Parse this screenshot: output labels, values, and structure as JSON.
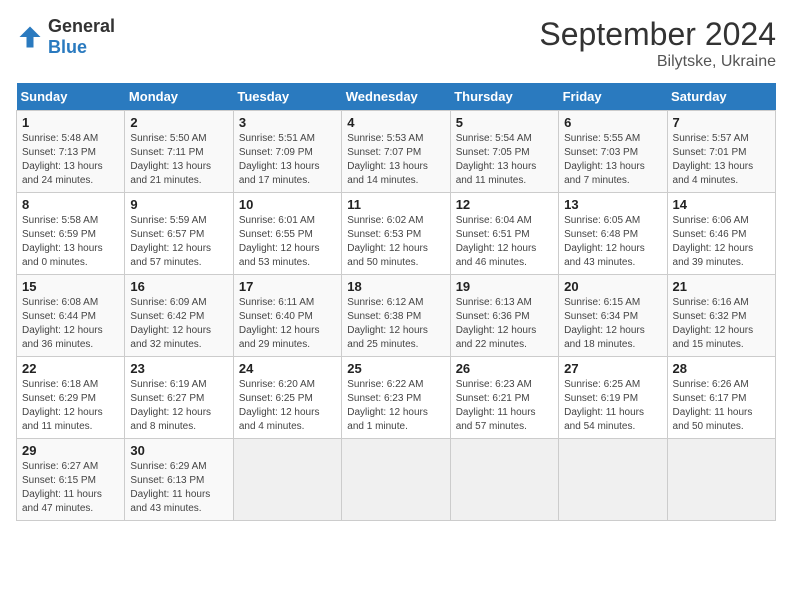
{
  "logo": {
    "general": "General",
    "blue": "Blue"
  },
  "title": "September 2024",
  "subtitle": "Bilytske, Ukraine",
  "days_header": [
    "Sunday",
    "Monday",
    "Tuesday",
    "Wednesday",
    "Thursday",
    "Friday",
    "Saturday"
  ],
  "weeks": [
    [
      {
        "day": "1",
        "info": "Sunrise: 5:48 AM\nSunset: 7:13 PM\nDaylight: 13 hours\nand 24 minutes."
      },
      {
        "day": "2",
        "info": "Sunrise: 5:50 AM\nSunset: 7:11 PM\nDaylight: 13 hours\nand 21 minutes."
      },
      {
        "day": "3",
        "info": "Sunrise: 5:51 AM\nSunset: 7:09 PM\nDaylight: 13 hours\nand 17 minutes."
      },
      {
        "day": "4",
        "info": "Sunrise: 5:53 AM\nSunset: 7:07 PM\nDaylight: 13 hours\nand 14 minutes."
      },
      {
        "day": "5",
        "info": "Sunrise: 5:54 AM\nSunset: 7:05 PM\nDaylight: 13 hours\nand 11 minutes."
      },
      {
        "day": "6",
        "info": "Sunrise: 5:55 AM\nSunset: 7:03 PM\nDaylight: 13 hours\nand 7 minutes."
      },
      {
        "day": "7",
        "info": "Sunrise: 5:57 AM\nSunset: 7:01 PM\nDaylight: 13 hours\nand 4 minutes."
      }
    ],
    [
      {
        "day": "8",
        "info": "Sunrise: 5:58 AM\nSunset: 6:59 PM\nDaylight: 13 hours\nand 0 minutes."
      },
      {
        "day": "9",
        "info": "Sunrise: 5:59 AM\nSunset: 6:57 PM\nDaylight: 12 hours\nand 57 minutes."
      },
      {
        "day": "10",
        "info": "Sunrise: 6:01 AM\nSunset: 6:55 PM\nDaylight: 12 hours\nand 53 minutes."
      },
      {
        "day": "11",
        "info": "Sunrise: 6:02 AM\nSunset: 6:53 PM\nDaylight: 12 hours\nand 50 minutes."
      },
      {
        "day": "12",
        "info": "Sunrise: 6:04 AM\nSunset: 6:51 PM\nDaylight: 12 hours\nand 46 minutes."
      },
      {
        "day": "13",
        "info": "Sunrise: 6:05 AM\nSunset: 6:48 PM\nDaylight: 12 hours\nand 43 minutes."
      },
      {
        "day": "14",
        "info": "Sunrise: 6:06 AM\nSunset: 6:46 PM\nDaylight: 12 hours\nand 39 minutes."
      }
    ],
    [
      {
        "day": "15",
        "info": "Sunrise: 6:08 AM\nSunset: 6:44 PM\nDaylight: 12 hours\nand 36 minutes."
      },
      {
        "day": "16",
        "info": "Sunrise: 6:09 AM\nSunset: 6:42 PM\nDaylight: 12 hours\nand 32 minutes."
      },
      {
        "day": "17",
        "info": "Sunrise: 6:11 AM\nSunset: 6:40 PM\nDaylight: 12 hours\nand 29 minutes."
      },
      {
        "day": "18",
        "info": "Sunrise: 6:12 AM\nSunset: 6:38 PM\nDaylight: 12 hours\nand 25 minutes."
      },
      {
        "day": "19",
        "info": "Sunrise: 6:13 AM\nSunset: 6:36 PM\nDaylight: 12 hours\nand 22 minutes."
      },
      {
        "day": "20",
        "info": "Sunrise: 6:15 AM\nSunset: 6:34 PM\nDaylight: 12 hours\nand 18 minutes."
      },
      {
        "day": "21",
        "info": "Sunrise: 6:16 AM\nSunset: 6:32 PM\nDaylight: 12 hours\nand 15 minutes."
      }
    ],
    [
      {
        "day": "22",
        "info": "Sunrise: 6:18 AM\nSunset: 6:29 PM\nDaylight: 12 hours\nand 11 minutes."
      },
      {
        "day": "23",
        "info": "Sunrise: 6:19 AM\nSunset: 6:27 PM\nDaylight: 12 hours\nand 8 minutes."
      },
      {
        "day": "24",
        "info": "Sunrise: 6:20 AM\nSunset: 6:25 PM\nDaylight: 12 hours\nand 4 minutes."
      },
      {
        "day": "25",
        "info": "Sunrise: 6:22 AM\nSunset: 6:23 PM\nDaylight: 12 hours\nand 1 minute."
      },
      {
        "day": "26",
        "info": "Sunrise: 6:23 AM\nSunset: 6:21 PM\nDaylight: 11 hours\nand 57 minutes."
      },
      {
        "day": "27",
        "info": "Sunrise: 6:25 AM\nSunset: 6:19 PM\nDaylight: 11 hours\nand 54 minutes."
      },
      {
        "day": "28",
        "info": "Sunrise: 6:26 AM\nSunset: 6:17 PM\nDaylight: 11 hours\nand 50 minutes."
      }
    ],
    [
      {
        "day": "29",
        "info": "Sunrise: 6:27 AM\nSunset: 6:15 PM\nDaylight: 11 hours\nand 47 minutes."
      },
      {
        "day": "30",
        "info": "Sunrise: 6:29 AM\nSunset: 6:13 PM\nDaylight: 11 hours\nand 43 minutes."
      },
      {
        "day": "",
        "info": ""
      },
      {
        "day": "",
        "info": ""
      },
      {
        "day": "",
        "info": ""
      },
      {
        "day": "",
        "info": ""
      },
      {
        "day": "",
        "info": ""
      }
    ]
  ]
}
